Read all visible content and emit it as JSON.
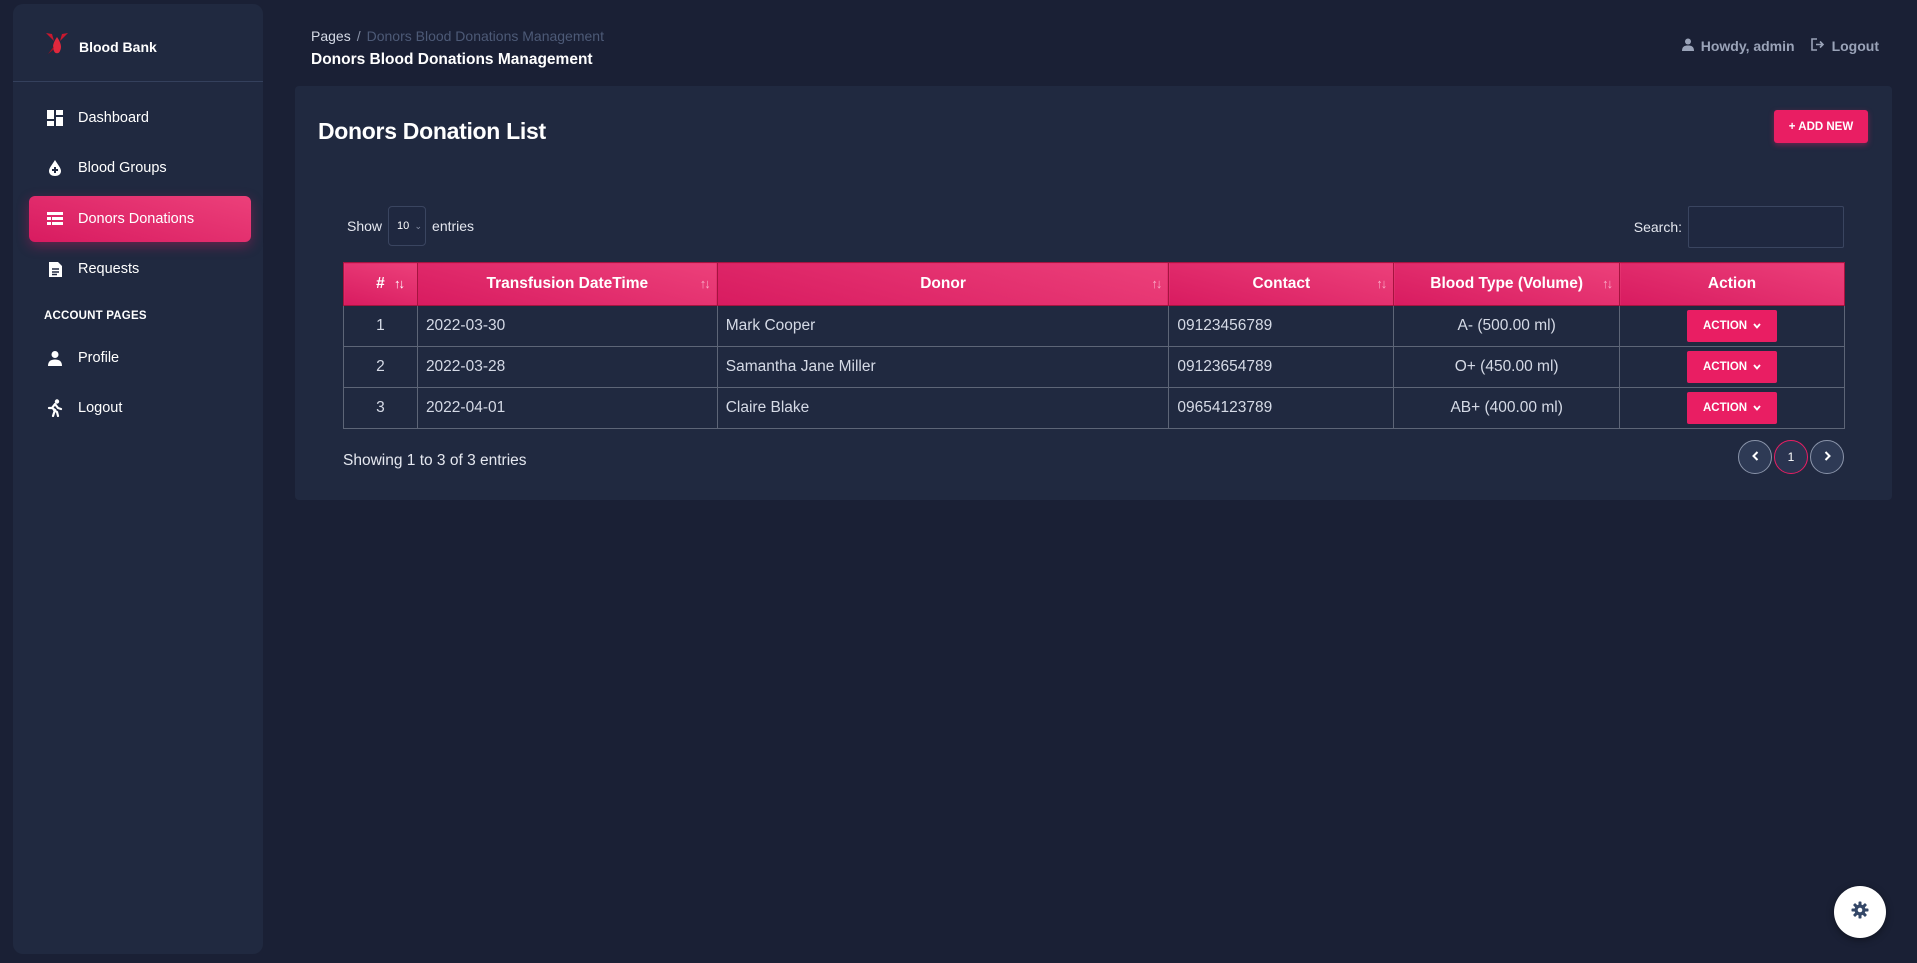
{
  "brand": {
    "name": "Blood Bank"
  },
  "sidebar": {
    "items": [
      {
        "label": "Dashboard",
        "icon": "dashboard-icon"
      },
      {
        "label": "Blood Groups",
        "icon": "blood-drop-icon"
      },
      {
        "label": "Donors Donations",
        "icon": "table-list-icon",
        "active": true
      },
      {
        "label": "Requests",
        "icon": "document-icon"
      }
    ],
    "section_label": "ACCOUNT PAGES",
    "account_items": [
      {
        "label": "Profile",
        "icon": "person-icon"
      },
      {
        "label": "Logout",
        "icon": "running-person-icon"
      }
    ]
  },
  "header": {
    "breadcrumb_root": "Pages",
    "breadcrumb_separator": "/",
    "breadcrumb_current": "Donors Blood Donations Management",
    "title": "Donors Blood Donations Management",
    "user_greeting": "Howdy, admin",
    "logout_label": "Logout"
  },
  "card": {
    "title": "Donors Donation List",
    "add_button": "+ ADD NEW"
  },
  "table_controls": {
    "show_label": "Show",
    "entries_value": "10",
    "entries_label": "entries",
    "search_label": "Search:",
    "search_value": ""
  },
  "table": {
    "columns": [
      "#",
      "Transfusion DateTime",
      "Donor",
      "Contact",
      "Blood Type (Volume)",
      "Action"
    ],
    "rows": [
      {
        "num": "1",
        "datetime": "2022-03-30",
        "donor": "Mark Cooper",
        "contact": "09123456789",
        "blood": "A- (500.00 ml)",
        "action": "ACTION"
      },
      {
        "num": "2",
        "datetime": "2022-03-28",
        "donor": "Samantha Jane Miller",
        "contact": "09123654789",
        "blood": "O+ (450.00 ml)",
        "action": "ACTION"
      },
      {
        "num": "3",
        "datetime": "2022-04-01",
        "donor": "Claire Blake",
        "contact": "09654123789",
        "blood": "AB+ (400.00 ml)",
        "action": "ACTION"
      }
    ]
  },
  "footer_info": "Showing 1 to 3 of 3 entries",
  "pagination": {
    "current_page": "1"
  },
  "colors": {
    "accent": "#e91e63",
    "background": "#1a2035",
    "card": "#202940"
  }
}
